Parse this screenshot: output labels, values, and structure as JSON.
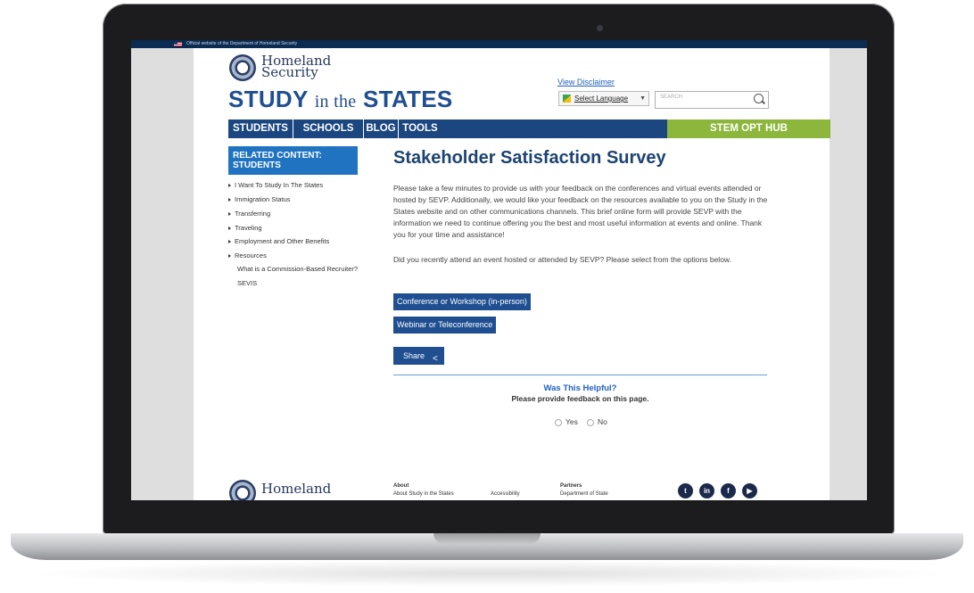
{
  "gov_banner": {
    "text": "Official website of the Department of Homeland Security"
  },
  "header": {
    "agency_line1": "Homeland",
    "agency_line2": "Security",
    "site_title_study": "STUDY",
    "site_title_in_the": "in the",
    "site_title_states": "STATES",
    "view_disclaimer": "View Disclaimer",
    "select_language": "Select Language",
    "search_placeholder": "SEARCH"
  },
  "nav": {
    "items": [
      {
        "label": "STUDENTS"
      },
      {
        "label": "SCHOOLS"
      },
      {
        "label": "BLOG"
      },
      {
        "label": "TOOLS"
      }
    ],
    "stem": "STEM OPT HUB"
  },
  "sidebar": {
    "heading": "RELATED CONTENT: STUDENTS",
    "items": [
      {
        "label": "I Want To Study In The States"
      },
      {
        "label": "Immigration Status"
      },
      {
        "label": "Transferring"
      },
      {
        "label": "Traveling"
      },
      {
        "label": "Employment and Other Benefits"
      },
      {
        "label": "Resources"
      }
    ],
    "subitems": [
      {
        "label": "What is a Commission-Based Recruiter?"
      },
      {
        "label": "SEVIS"
      }
    ]
  },
  "main": {
    "title": "Stakeholder Satisfaction Survey",
    "intro": "Please take a few minutes to provide us with your feedback on the conferences and virtual events attended or hosted by SEVP. Additionally, we would like your feedback on the resources available to you on the Study in the States website and on other communications channels. This brief online form will provide SEVP with the information we need to continue offering you the best and most useful information at events and online. Thank you for your time and assistance!",
    "question": "Did you recently attend an event hosted or attended by SEVP? Please select from the options below.",
    "option_conference": "Conference or Workshop (in-person)",
    "option_webinar": "Webinar or Teleconference",
    "share": "Share",
    "helpful_title": "Was This Helpful?",
    "helpful_sub": "Please provide feedback on this page.",
    "yes": "Yes",
    "no": "No"
  },
  "footer": {
    "agency": "Homeland",
    "about_heading": "About",
    "about_link": "About Study in the States",
    "accessibility": "Accessibility",
    "partners_heading": "Partners",
    "partners_link": "Department of State",
    "social": [
      {
        "icon": "twitter-icon",
        "glyph": "t"
      },
      {
        "icon": "linkedin-icon",
        "glyph": "in"
      },
      {
        "icon": "facebook-icon",
        "glyph": "f"
      },
      {
        "icon": "youtube-icon",
        "glyph": "▶"
      }
    ]
  },
  "colors": {
    "brand_blue": "#1f4e91",
    "stem_green": "#8cb63c",
    "link_blue": "#1f5fbf"
  }
}
